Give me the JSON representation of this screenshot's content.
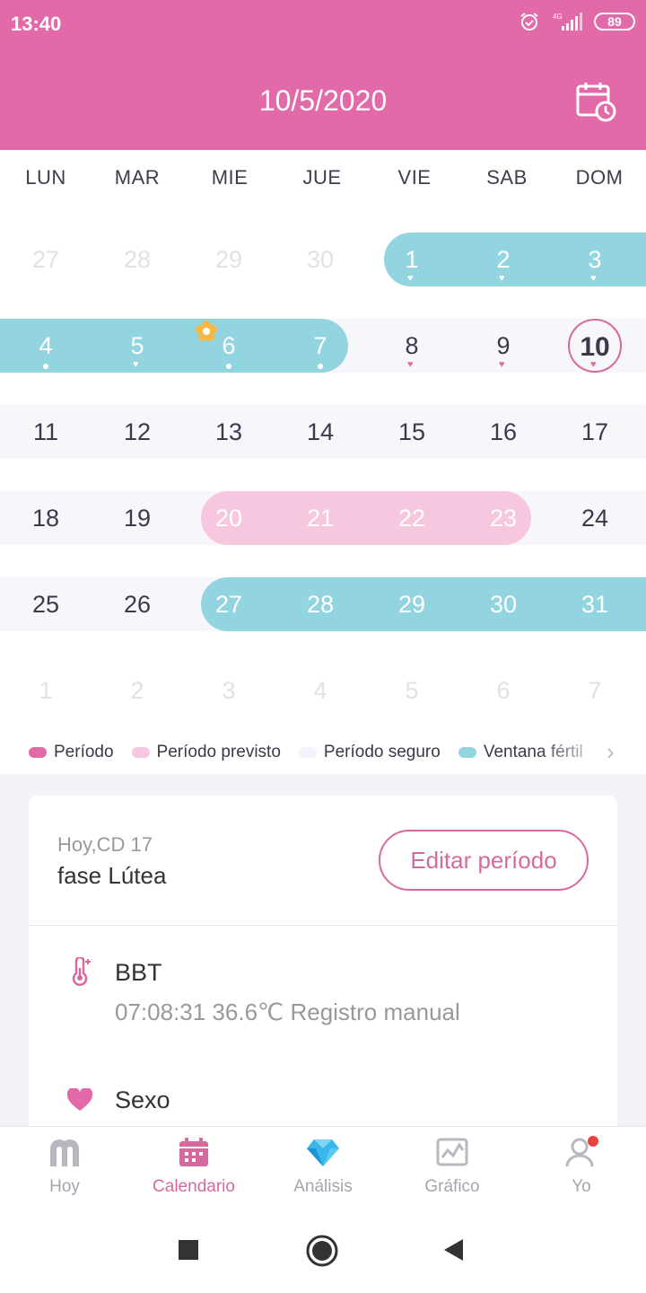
{
  "status_bar": {
    "time": "13:40",
    "network": "4G",
    "battery": "89"
  },
  "header": {
    "date": "10/5/2020",
    "calendar_icon": "calendar-clock-icon"
  },
  "colors": {
    "brand_pink": "#e36aa8",
    "fertile": "#92d5e0",
    "predicted_period": "#f6c7de",
    "safe": "#f7f6fb",
    "accent": "#d66aa0"
  },
  "weekdays": [
    "LUN",
    "MAR",
    "MIE",
    "JUE",
    "VIE",
    "SAB",
    "DOM"
  ],
  "weeks": [
    [
      "27",
      "28",
      "29",
      "30",
      "1",
      "2",
      "3"
    ],
    [
      "4",
      "5",
      "6",
      "7",
      "8",
      "9",
      "10"
    ],
    [
      "11",
      "12",
      "13",
      "14",
      "15",
      "16",
      "17"
    ],
    [
      "18",
      "19",
      "20",
      "21",
      "22",
      "23",
      "24"
    ],
    [
      "25",
      "26",
      "27",
      "28",
      "29",
      "30",
      "31"
    ],
    [
      "1",
      "2",
      "3",
      "4",
      "5",
      "6",
      "7"
    ]
  ],
  "legend": [
    {
      "label": "Período",
      "color": "#e36aa8"
    },
    {
      "label": "Período previsto",
      "color": "#f6c7de"
    },
    {
      "label": "Período seguro",
      "color": "#f4f2fa"
    },
    {
      "label": "Ventana fértil",
      "color": "#92d5e0"
    }
  ],
  "summary": {
    "cycle_day": "Hoy,CD 17",
    "phase": "fase Lútea",
    "edit_button": "Editar período"
  },
  "records": {
    "bbt_title": "BBT",
    "bbt_value": "07:08:31 36.6℃ Registro manual",
    "sex_title": "Sexo"
  },
  "nav": [
    {
      "label": "Hoy",
      "icon": "today-icon"
    },
    {
      "label": "Calendario",
      "icon": "calendar-icon",
      "active": true
    },
    {
      "label": "Análisis",
      "icon": "diamond-icon"
    },
    {
      "label": "Gráfico",
      "icon": "chart-icon"
    },
    {
      "label": "Yo",
      "icon": "profile-icon"
    }
  ]
}
